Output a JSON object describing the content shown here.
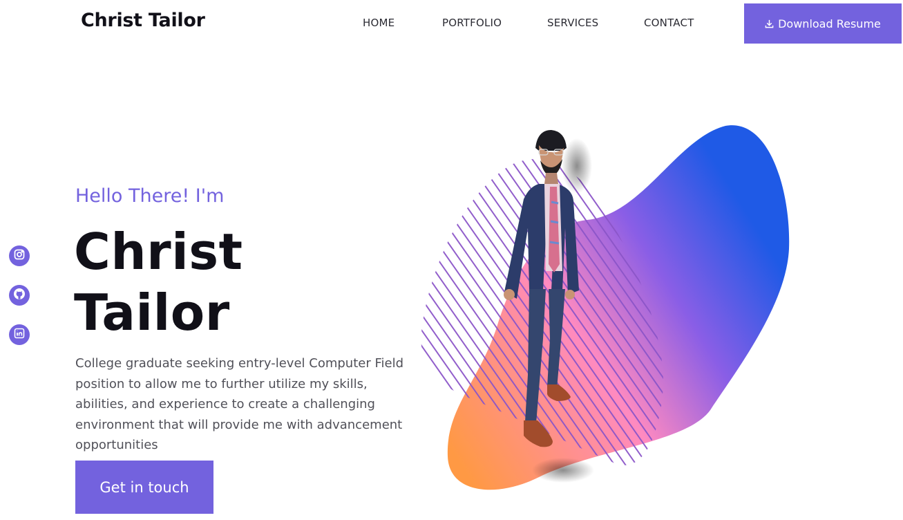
{
  "header": {
    "brand": "Christ Tailor",
    "nav": [
      {
        "label": "HOME"
      },
      {
        "label": "PORTFOLIO"
      },
      {
        "label": "SERVICES"
      },
      {
        "label": "CONTACT"
      }
    ],
    "download_button": {
      "label": "Download Resume",
      "icon": "download-icon"
    }
  },
  "socials": [
    {
      "icon": "instagram-icon"
    },
    {
      "icon": "github-icon"
    },
    {
      "icon": "linkedin-icon"
    }
  ],
  "hero": {
    "greeting": "Hello There! I'm",
    "name_line1": "Christ",
    "name_line2": "Tailor",
    "intro": "College graduate seeking entry-level Computer Field position to allow me to further utilize my skills, abilities, and experience to create a challenging environment that will provide me with advancement opportunities",
    "cta_label": "Get in touch"
  },
  "colors": {
    "accent": "#7362de",
    "heading": "#111018",
    "body_text": "#505058",
    "blob_orange": "#ff9944",
    "blob_pink": "#ff8ac0",
    "blob_purple": "#8a5ee6",
    "blob_blue": "#1f5ae6"
  }
}
